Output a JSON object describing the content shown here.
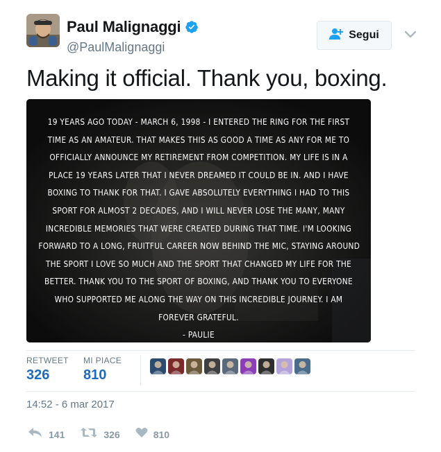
{
  "user": {
    "display_name": "Paul Malignaggi",
    "handle": "@PaulMalignaggi"
  },
  "follow_button": {
    "label": "Segui"
  },
  "tweet": {
    "text": "Making it official. Thank you, boxing."
  },
  "media": {
    "lines": [
      "19 years ago today - March 6, 1998 - I entered the ring for the first",
      "time as an amateur. That makes this as good a time as any for me to",
      "officially announce my retirement from competition. My life is in a",
      "place 19 years later that I never dreamed it could be in. And I have",
      "boxing to thank for that. I gave absolutely everything I had to this",
      "sport for almost 2 decades, and I will never lose the many, many",
      "incredible memories that were created during that time. I'm looking",
      "forward to a long, fruitful career now behind the mic, staying around",
      "the sport I love so much and the sport that changed my life for the",
      "better. Thank you to the sport of boxing, and thank you to everyone",
      "who supported me along the way on this incredible journey. I am",
      "forever grateful.",
      "- Paulie"
    ]
  },
  "stats": {
    "retweet_label": "RETWEET",
    "retweet_count": "326",
    "like_label": "MI PIACE",
    "like_count": "810"
  },
  "likers": [
    {
      "icon": "liker-avatar-1",
      "color": "#2b4a6f"
    },
    {
      "icon": "liker-avatar-2",
      "color": "#7a2a2a"
    },
    {
      "icon": "liker-avatar-3",
      "color": "#6b5a3c"
    },
    {
      "icon": "liker-avatar-4",
      "color": "#3f3f3f"
    },
    {
      "icon": "liker-avatar-5",
      "color": "#5a6a7a"
    },
    {
      "icon": "liker-avatar-6",
      "color": "#8a3fb5"
    },
    {
      "icon": "liker-avatar-7",
      "color": "#2e2e2e"
    },
    {
      "icon": "liker-avatar-8",
      "color": "#b3a3d9"
    },
    {
      "icon": "liker-avatar-9",
      "color": "#4a6b8a"
    }
  ],
  "timestamp": "14:52 - 6 mar 2017",
  "actions": {
    "reply_count": "141",
    "retweet_count": "326",
    "like_count": "810"
  },
  "colors": {
    "link_blue": "#1b6bbf",
    "verified_blue": "#1da1f2",
    "muted_gray": "#657786",
    "action_gray": "#8899a6"
  }
}
